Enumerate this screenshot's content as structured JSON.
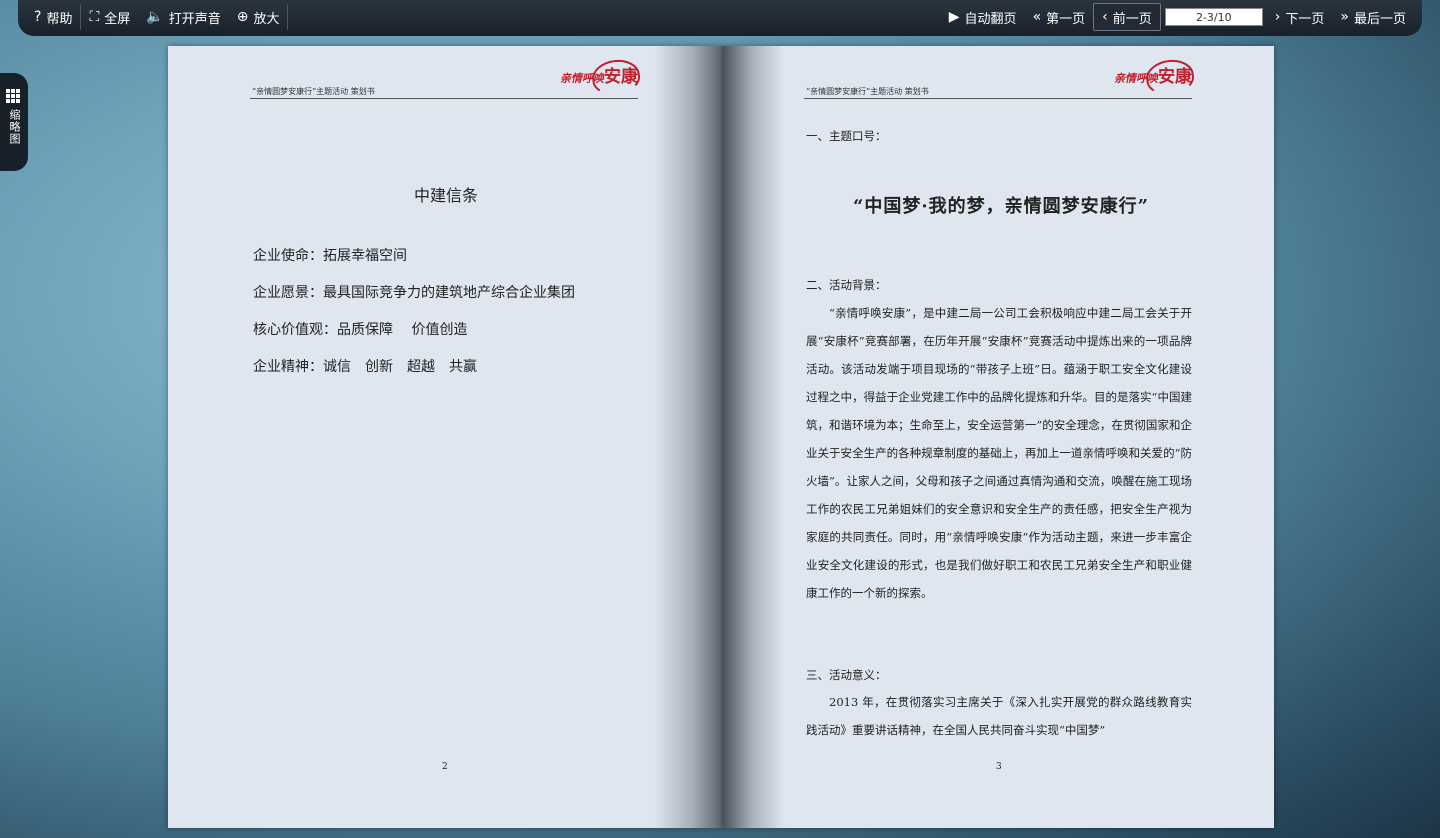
{
  "toolbar": {
    "help": "帮助",
    "fullscreen": "全屏",
    "sound": "打开声音",
    "zoom": "放大",
    "auto_flip": "自动翻页",
    "first": "第一页",
    "prev": "前一页",
    "page_value": "2-3/10",
    "next": "下一页",
    "last": "最后一页"
  },
  "sidetab": {
    "label": "缩略图"
  },
  "header": {
    "text": "“亲情圆梦安康行”主题活动 策划书",
    "logo_small": "亲情呼唤",
    "logo_big": "安康"
  },
  "left_page": {
    "title": "中建信条",
    "lines": [
      "企业使命：拓展幸福空间",
      "企业愿景：最具国际竞争力的建筑地产综合企业集团",
      "核心价值观：品质保障　 价值创造",
      "企业精神：诚信　创新　超越　共赢"
    ],
    "page_number": "2"
  },
  "right_page": {
    "h1": "一、主题口号：",
    "slogan": "“中国梦·我的梦，亲情圆梦安康行”",
    "h2": "二、活动背景：",
    "p1": "“亲情呼唤安康”，是中建二局一公司工会积极响应中建二局工会关于开展“安康杯”竞赛部署，在历年开展“安康杯”竞赛活动中提炼出来的一项品牌活动。该活动发端于项目现场的“带孩子上班”日。蕴涵于职工安全文化建设过程之中，得益于企业党建工作中的品牌化提炼和升华。目的是落实“中国建筑，和谐环境为本；生命至上，安全运营第一”的安全理念，在贯彻国家和企业关于安全生产的各种规章制度的基础上，再加上一道亲情呼唤和关爱的“防火墙”。让家人之间，父母和孩子之间通过真情沟通和交流，唤醒在施工现场工作的农民工兄弟姐妹们的安全意识和安全生产的责任感，把安全生产视为家庭的共同责任。同时，用“亲情呼唤安康”作为活动主题，来进一步丰富企业安全文化建设的形式，也是我们做好职工和农民工兄弟安全生产和职业健康工作的一个新的探索。",
    "h3": "三、活动意义：",
    "p2": "2013 年，在贯彻落实习主席关于《深入扎实开展党的群众路线教育实践活动》重要讲话精神，在全国人民共同奋斗实现“中国梦”",
    "page_number": "3"
  }
}
